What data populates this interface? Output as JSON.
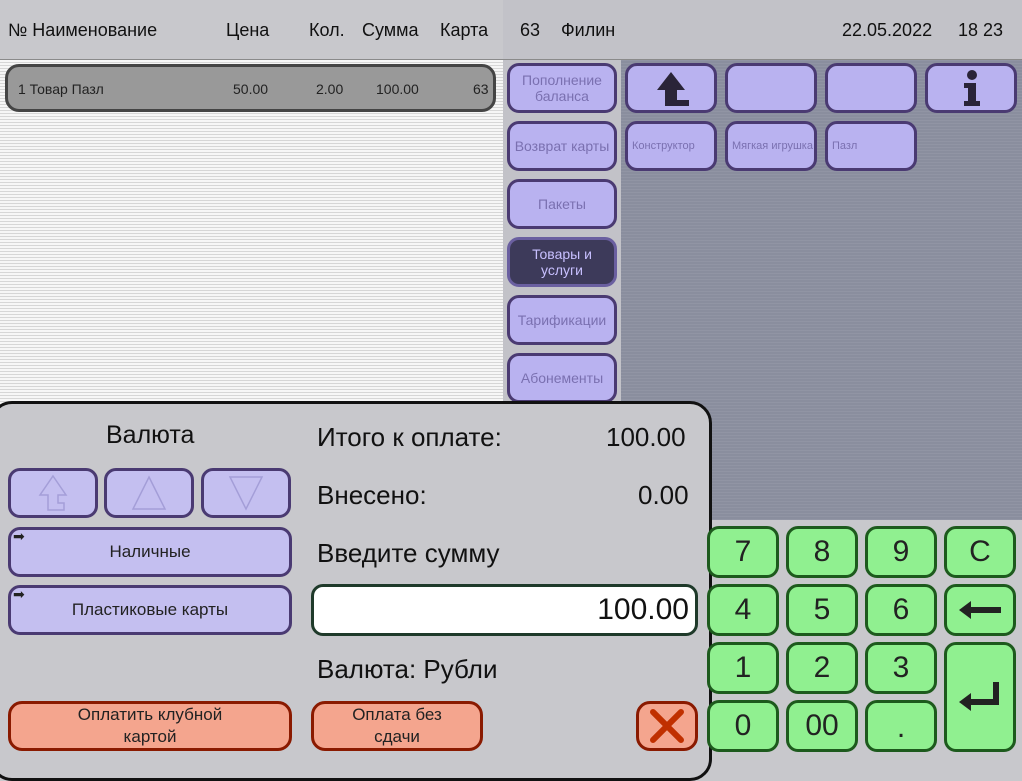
{
  "header": {
    "col_name": "№ Наименование",
    "col_price": "Цена",
    "col_qty": "Кол.",
    "col_sum": "Сумма",
    "col_card": "Карта",
    "terminal_no": "63",
    "cashier": "Филин",
    "date": "22.05.2022",
    "time": "18 23"
  },
  "order": {
    "rows": [
      {
        "line": "1 Товар Пазл",
        "price": "50.00",
        "qty": "2.00",
        "sum": "100.00",
        "card": "63"
      }
    ]
  },
  "categories": [
    {
      "label": "Пополнение баланса",
      "active": false
    },
    {
      "label": "Возврат карты",
      "active": false
    },
    {
      "label": "Пакеты",
      "active": false
    },
    {
      "label": "Товары и услуги",
      "active": true
    },
    {
      "label": "Тарификации",
      "active": false
    },
    {
      "label": "Абонементы",
      "active": false
    }
  ],
  "top_buttons": [
    "up-folder-icon",
    "",
    "",
    "info-icon"
  ],
  "products": [
    "Конструктор",
    "Мягкая игрушка",
    "Пазл"
  ],
  "payment": {
    "currency_title": "Валюта",
    "total_label": "Итого к оплате:",
    "total_value": "100.00",
    "paid_label": "Внесено:",
    "paid_value": "0.00",
    "enter_label": "Введите сумму",
    "amount_value": "100.00",
    "currency_label": "Валюта: Рубли",
    "methods": [
      "Наличные",
      "Пластиковые карты"
    ],
    "club_card_button": "Оплатить клубной картой",
    "no_change_button": "Оплата без сдачи"
  },
  "keypad": {
    "keys": [
      "7",
      "8",
      "9",
      "C",
      "4",
      "5",
      "6",
      "",
      "1",
      "2",
      "3",
      "",
      "0",
      "00",
      "."
    ]
  },
  "colors": {
    "category_button": "#b9b2f0",
    "category_active": "#3d3a5a",
    "keypad_green": "#90f090",
    "orange_button": "#f4a58e",
    "cancel_red": "#c03000"
  }
}
